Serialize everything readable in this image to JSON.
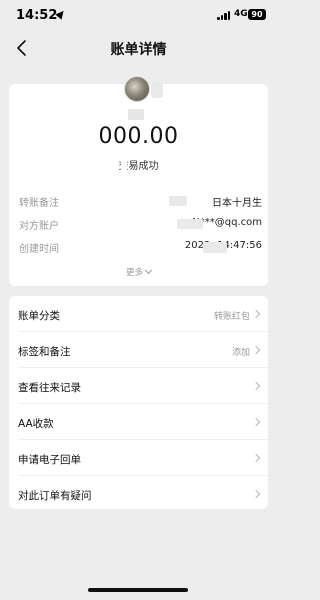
{
  "status_bar": {
    "time": "14:52",
    "network": "4G",
    "battery": "90"
  },
  "nav": {
    "title": "账单详情"
  },
  "summary": {
    "amount": "000.00",
    "status": "交易成功",
    "details": [
      {
        "label": "转账备注",
        "value": "日本十月生"
      },
      {
        "label": "对方账户",
        "value": "N***@qq.com"
      },
      {
        "label": "创建时间",
        "value": "2023-      14:47:56"
      }
    ],
    "more_label": "更多"
  },
  "actions": [
    {
      "label": "账单分类",
      "value": "转账红包"
    },
    {
      "label": "标签和备注",
      "value": "添加"
    },
    {
      "label": "查看往来记录",
      "value": ""
    },
    {
      "label": "AA收款",
      "value": ""
    },
    {
      "label": "申请电子回单",
      "value": ""
    },
    {
      "label": "对此订单有疑问",
      "value": ""
    }
  ],
  "colors": {
    "background": "#ededed",
    "card": "#ffffff",
    "label_grey": "#999999"
  },
  "icons": {
    "back": "chevron-left-icon",
    "row_arrow": "chevron-right-icon",
    "more": "chevron-down-icon"
  }
}
